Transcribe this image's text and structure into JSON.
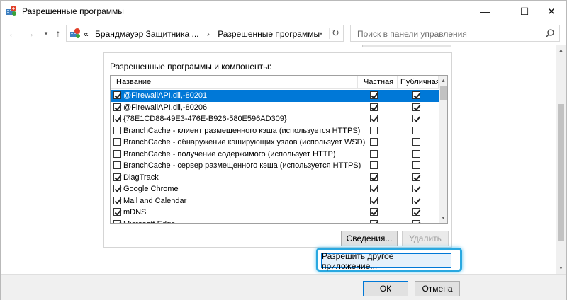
{
  "window": {
    "title": "Разрешенные программы",
    "controls": {
      "minimize": "—",
      "maximize": "☐",
      "close": "✕"
    }
  },
  "nav": {
    "back": "←",
    "forward": "→",
    "history": "▾",
    "up": "↑",
    "breadcrumb_prefix": "«",
    "breadcrumb": [
      "Брандмауэр Защитника ...",
      "Разрешенные программы"
    ],
    "breadcrumb_separator": "›",
    "address_dropdown": "▾",
    "refresh": "↻",
    "search_placeholder": "Поиск в панели управления"
  },
  "content": {
    "group_label": "Разрешенные программы и компоненты:",
    "columns": {
      "name": "Название",
      "private": "Частная",
      "public": "Публичная"
    },
    "rows": [
      {
        "name": "@FirewallAPI.dll,-80201",
        "enabled": true,
        "private": true,
        "public": true,
        "selected": true
      },
      {
        "name": "@FirewallAPI.dll,-80206",
        "enabled": true,
        "private": true,
        "public": true,
        "selected": false
      },
      {
        "name": "{78E1CD88-49E3-476E-B926-580E596AD309}",
        "enabled": true,
        "private": true,
        "public": true,
        "selected": false
      },
      {
        "name": "BranchCache - клиент размещенного кэша (используется HTTPS)",
        "enabled": false,
        "private": false,
        "public": false,
        "selected": false
      },
      {
        "name": "BranchCache - обнаружение кэширующих узлов (использует WSD)",
        "enabled": false,
        "private": false,
        "public": false,
        "selected": false
      },
      {
        "name": "BranchCache - получение содержимого (использует HTTP)",
        "enabled": false,
        "private": false,
        "public": false,
        "selected": false
      },
      {
        "name": "BranchCache - сервер размещенного кэша (используется HTTPS)",
        "enabled": false,
        "private": false,
        "public": false,
        "selected": false
      },
      {
        "name": "DiagTrack",
        "enabled": true,
        "private": true,
        "public": true,
        "selected": false
      },
      {
        "name": "Google Chrome",
        "enabled": true,
        "private": true,
        "public": true,
        "selected": false
      },
      {
        "name": "Mail and Calendar",
        "enabled": true,
        "private": true,
        "public": true,
        "selected": false
      },
      {
        "name": "mDNS",
        "enabled": true,
        "private": true,
        "public": true,
        "selected": false
      },
      {
        "name": "Microsoft Edge",
        "enabled": true,
        "private": true,
        "public": true,
        "selected": false
      }
    ],
    "details_button": "Сведения...",
    "delete_button": "Удалить",
    "allow_other_button": "Разрешить другое приложение..."
  },
  "footer": {
    "ok": "ОК",
    "cancel": "Отмена"
  },
  "colors": {
    "selection": "#0078d7",
    "highlight_ring": "#29a8e0"
  }
}
